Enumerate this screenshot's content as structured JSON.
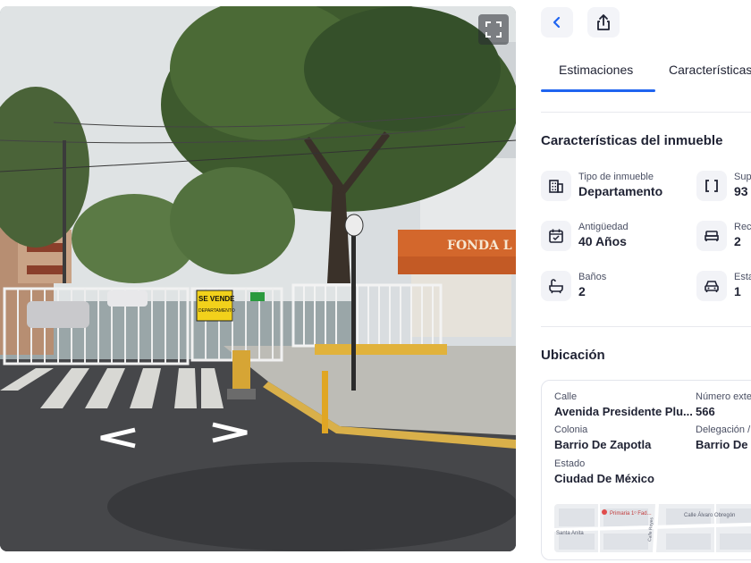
{
  "street_view": {
    "sign_sale_text": "SE VENDE",
    "sign_sale_sub": "DEPARTAMENTO",
    "shop_sign": "FONDA L",
    "expand_icon": "expand-icon",
    "nav_left_icon": "arrow-left-icon",
    "nav_right_icon": "arrow-right-icon"
  },
  "header": {
    "back_icon": "chevron-left-icon",
    "share_icon": "share-icon"
  },
  "tabs": [
    {
      "label": "Estimaciones",
      "active": true
    },
    {
      "label": "Características"
    }
  ],
  "features": {
    "title": "Características del inmueble",
    "items": [
      {
        "label": "Tipo de inmueble",
        "value": "Departamento",
        "icon": "building-icon"
      },
      {
        "label": "Sup",
        "value": "93",
        "icon": "area-icon"
      },
      {
        "label": "Antigüedad",
        "value": "40 Años",
        "icon": "calendar-icon"
      },
      {
        "label": "Rec",
        "value": "2",
        "icon": "bed-icon"
      },
      {
        "label": "Baños",
        "value": "2",
        "icon": "bathtub-icon"
      },
      {
        "label": "Esta",
        "value": "1",
        "icon": "car-icon"
      }
    ]
  },
  "location": {
    "title": "Ubicación",
    "fields": [
      {
        "label": "Calle",
        "value": "Avenida Presidente Plu..."
      },
      {
        "label": "Número exte",
        "value": "566"
      },
      {
        "label": "Colonia",
        "value": "Barrio De Zapotla"
      },
      {
        "label": "Delegación /",
        "value": "Barrio De Z"
      },
      {
        "label": "Estado",
        "value": "Ciudad De México"
      }
    ],
    "map_labels": [
      "Primaria 1ᵒ Fad...",
      "Calle Álvaro Obregón",
      "Calle Reyes",
      "Santa Anita"
    ]
  },
  "colors": {
    "accent": "#1f64f0",
    "text": "#1f2233",
    "icon_bg": "#f2f3f7"
  }
}
